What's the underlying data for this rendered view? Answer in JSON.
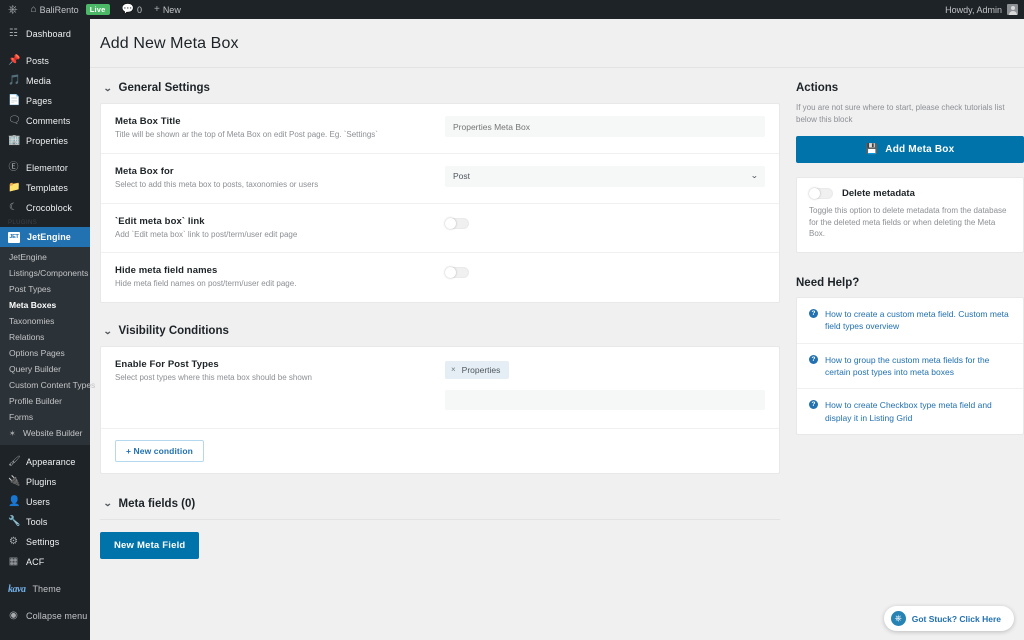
{
  "adminbar": {
    "wp_logo_icon": "wordpress-logo-icon",
    "site_icon": "home-icon",
    "site_name": "BaliRento",
    "live_badge": "Live",
    "comments_icon": "comment-icon",
    "comments_count": "0",
    "new_icon": "plus-icon",
    "new_label": "New",
    "howdy": "Howdy, Admin"
  },
  "sidebar": {
    "items": [
      {
        "label": "Dashboard",
        "icon": "dashboard-icon",
        "glyph": "⌘"
      },
      {
        "label": "Posts",
        "icon": "pin-icon",
        "glyph": "✐"
      },
      {
        "label": "Media",
        "icon": "media-icon",
        "glyph": "♪"
      },
      {
        "label": "Pages",
        "icon": "page-icon",
        "glyph": "▀"
      },
      {
        "label": "Comments",
        "icon": "comment-icon",
        "glyph": "▭"
      },
      {
        "label": "Properties",
        "icon": "building-icon",
        "glyph": "▓"
      },
      {
        "label": "Elementor",
        "icon": "elementor-icon",
        "glyph": "Ⓔ"
      },
      {
        "label": "Templates",
        "icon": "folder-icon",
        "glyph": "▰"
      },
      {
        "label": "Crocoblock",
        "icon": "crocoblock-icon",
        "glyph": "☾"
      }
    ],
    "group_label": "PLUGINS",
    "active_item": {
      "label": "JetEngine",
      "icon": "jetengine-badge-icon",
      "badge": "JET"
    },
    "submenu": [
      {
        "label": "JetEngine",
        "current": false
      },
      {
        "label": "Listings/Components",
        "current": false
      },
      {
        "label": "Post Types",
        "current": false
      },
      {
        "label": "Meta Boxes",
        "current": true
      },
      {
        "label": "Taxonomies",
        "current": false
      },
      {
        "label": "Relations",
        "current": false
      },
      {
        "label": "Options Pages",
        "current": false
      },
      {
        "label": "Query Builder",
        "current": false
      },
      {
        "label": "Custom Content Types",
        "current": false
      },
      {
        "label": "Profile Builder",
        "current": false
      },
      {
        "label": "Forms",
        "current": false
      },
      {
        "label": "Website Builder",
        "current": false,
        "icon": "wand-icon",
        "glyph": "✦"
      }
    ],
    "bottom_items": [
      {
        "label": "Appearance",
        "icon": "brush-icon",
        "glyph": "✐"
      },
      {
        "label": "Plugins",
        "icon": "plug-icon",
        "glyph": "⚡"
      },
      {
        "label": "Users",
        "icon": "user-icon",
        "glyph": "⚹"
      },
      {
        "label": "Tools",
        "icon": "wrench-icon",
        "glyph": "⚒"
      },
      {
        "label": "Settings",
        "icon": "settings-icon",
        "glyph": "⚙"
      },
      {
        "label": "ACF",
        "icon": "acf-icon",
        "glyph": "▦"
      }
    ],
    "theme": {
      "logo": "kava",
      "label": "Theme"
    },
    "collapse": {
      "label": "Collapse menu",
      "icon": "collapse-icon",
      "glyph": "◀"
    }
  },
  "page": {
    "title": "Add New Meta Box"
  },
  "general_settings": {
    "heading": "General Settings",
    "chevron": "⌄",
    "rows": [
      {
        "title": "Meta Box Title",
        "desc": "Title will be shown ar the top of Meta Box on edit Post page. Eg. `Settings`",
        "type": "text",
        "value": "",
        "placeholder": "Properties Meta Box"
      },
      {
        "title": "Meta Box for",
        "desc": "Select to add this meta box to posts, taxonomies or users",
        "type": "select",
        "value": "Post"
      },
      {
        "title": "`Edit meta box` link",
        "desc": "Add `Edit meta box` link to post/term/user edit page",
        "type": "toggle",
        "value": "off"
      },
      {
        "title": "Hide meta field names",
        "desc": "Hide meta field names on post/term/user edit page.",
        "type": "toggle",
        "value": "off"
      }
    ]
  },
  "visibility_conditions": {
    "heading": "Visibility Conditions",
    "chevron": "⌄",
    "row": {
      "title": "Enable For Post Types",
      "desc": "Select post types where this meta box should be shown",
      "chip": {
        "label": "Properties",
        "remove_icon": "close-icon",
        "remove_glyph": "×"
      }
    },
    "new_condition_button": "+ New condition"
  },
  "meta_fields": {
    "heading": "Meta fields (0)",
    "chevron": "⌄",
    "new_field_button": "New Meta Field"
  },
  "actions": {
    "heading": "Actions",
    "note": "If you are not sure where to start, please check tutorials list below this block",
    "add_button": {
      "label": "Add Meta Box",
      "icon": "save-icon",
      "glyph": "💾"
    },
    "delete_metadata": {
      "label": "Delete metadata",
      "desc": "Toggle this option to delete metadata from the database for the deleted meta fields or when deleting the Meta Box.",
      "toggle": "off"
    }
  },
  "need_help": {
    "heading": "Need Help?",
    "items": [
      {
        "icon": "question-icon",
        "glyph": "?",
        "text": "How to create a custom meta field. Custom meta field types overview"
      },
      {
        "icon": "question-icon",
        "glyph": "?",
        "text": "How to group the custom meta fields for the certain post types into meta boxes"
      },
      {
        "icon": "question-icon",
        "glyph": "?",
        "text": "How to create Checkbox type meta field and display it in Listing Grid"
      }
    ]
  },
  "got_stuck": {
    "label": "Got Stuck? Click Here",
    "icon": "lifebuoy-icon",
    "glyph": "⎈"
  },
  "colors": {
    "admin_dark": "#1d2327",
    "accent_blue": "#2271b1",
    "button_blue": "#0073aa",
    "live_green": "#4ab866",
    "page_bg": "#f0f0f1"
  }
}
